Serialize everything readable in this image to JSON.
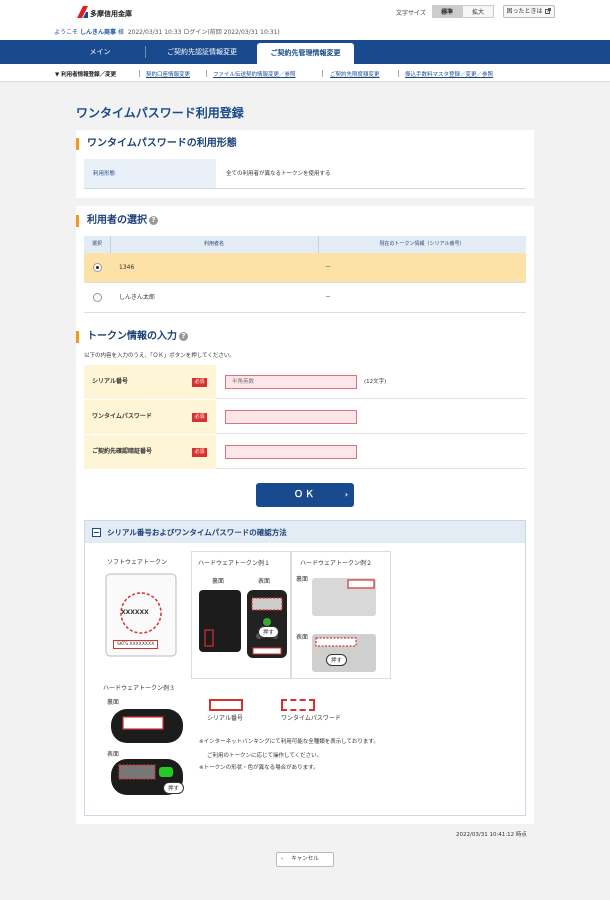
{
  "header": {
    "bank_name": "多摩信用金庫",
    "welcome_prefix": "ようこそ",
    "company": "しんきん商事",
    "honorific": "様",
    "login_info": "2022/03/31 10:33 ログイン(前回 2022/03/31 10:31)",
    "font_size_label": "文字サイズ",
    "font_standard": "標準",
    "font_large": "拡大",
    "help_label": "困ったときは"
  },
  "nav": {
    "tabs": [
      {
        "label": "メイン"
      },
      {
        "label": "ご契約先認証情報変更"
      },
      {
        "label": "ご契約先管理情報変更"
      }
    ],
    "subnav": [
      {
        "label": "利用者情報登録／変更"
      },
      {
        "label": "契約口座情報変更"
      },
      {
        "label": "ファイル伝送契約情報変更／参照"
      },
      {
        "label": "ご契約先限度額変更"
      },
      {
        "label": "振込手数料マスタ登録／変更／参照"
      }
    ]
  },
  "page_title": "ワンタイムパスワード利用登録",
  "usage_section": {
    "title": "ワンタイムパスワードの利用形態",
    "label": "利用形態",
    "value": "全ての利用者が異なるトークンを使用する"
  },
  "user_section": {
    "title": "利用者の選択",
    "columns": [
      "選択",
      "利用者名",
      "現在のトークン情報（シリアル番号）"
    ],
    "rows": [
      {
        "name": "1346",
        "token": "－",
        "selected": true
      },
      {
        "name": "しんきん太郎",
        "token": "－",
        "selected": false
      }
    ]
  },
  "token_section": {
    "title": "トークン情報の入力",
    "instruction": "以下の内容を入力のうえ、「ＯＫ」ボタンを押してください。",
    "required_label": "必須",
    "fields": [
      {
        "label": "シリアル番号",
        "placeholder": "半角英数",
        "value": "",
        "hint": "(12文字)"
      },
      {
        "label": "ワンタイムパスワード",
        "placeholder": "",
        "value": "",
        "hint": ""
      },
      {
        "label": "ご契約先確認暗証番号",
        "placeholder": "",
        "value": "",
        "hint": ""
      }
    ]
  },
  "ok_button": "ＯＫ",
  "guide": {
    "title": "シリアル番号およびワンタイムパスワードの確認方法",
    "software_token": "ソフトウェアトークン",
    "hardware_token_1": "ハードウェアトークン例１",
    "hardware_token_2": "ハードウェアトークン例２",
    "hardware_token_3": "ハードウェアトークン例３",
    "back": "裏面",
    "front": "表面",
    "press": "押す",
    "sw_code": "XXXXXX",
    "sw_serial": "SKTS XXXXXXXX",
    "legend_serial": "シリアル番号",
    "legend_otp": "ワンタイムパスワード",
    "note1": "※インターネットバンキングにて利用可能な全種類を表示しております。",
    "note2": "ご利用のトークンに応じて操作してください。",
    "note3": "※トークンの形状・色が異なる場合があります。"
  },
  "timestamp": "2022/03/31 10:41:12 時点",
  "cancel_button": "キャンセル",
  "colors": {
    "primary": "#1a4a8e",
    "accent": "#f29a1b",
    "required": "#d93030",
    "selected_row": "#fce2a6"
  }
}
